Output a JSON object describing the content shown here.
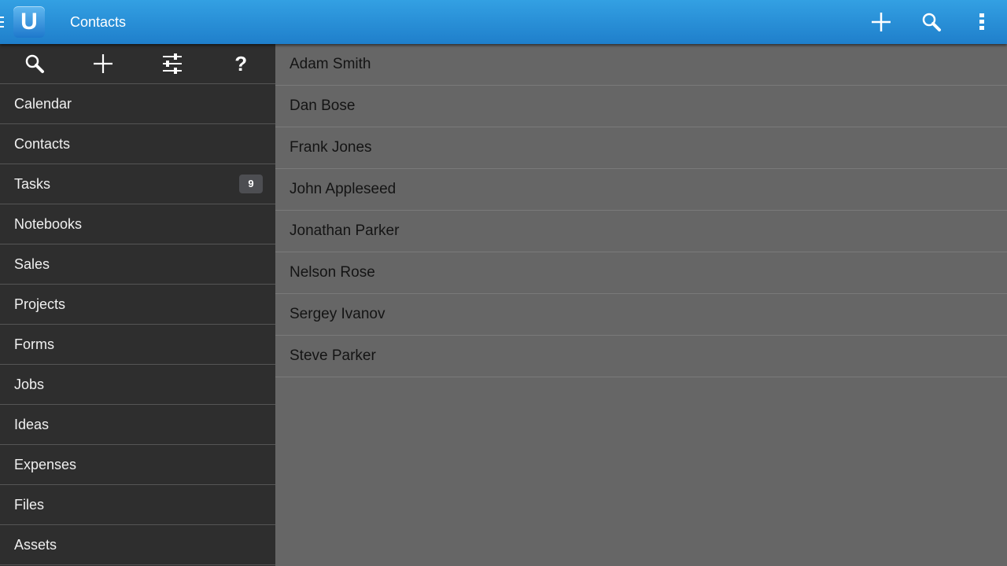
{
  "header": {
    "title": "Contacts",
    "logo_letter": "U",
    "actions": [
      {
        "name": "add",
        "icon": "plus-icon"
      },
      {
        "name": "search",
        "icon": "search-icon"
      },
      {
        "name": "overflow",
        "icon": "more-vert-icon"
      }
    ]
  },
  "sidebar": {
    "tools": [
      {
        "name": "search",
        "icon": "search-icon"
      },
      {
        "name": "add",
        "icon": "plus-icon"
      },
      {
        "name": "settings",
        "icon": "sliders-icon"
      },
      {
        "name": "help",
        "icon": "help-icon",
        "glyph": "?"
      }
    ],
    "items": [
      {
        "label": "Calendar"
      },
      {
        "label": "Contacts"
      },
      {
        "label": "Tasks",
        "badge": "9"
      },
      {
        "label": "Notebooks"
      },
      {
        "label": "Sales"
      },
      {
        "label": "Projects"
      },
      {
        "label": "Forms"
      },
      {
        "label": "Jobs"
      },
      {
        "label": "Ideas"
      },
      {
        "label": "Expenses"
      },
      {
        "label": "Files"
      },
      {
        "label": "Assets"
      }
    ]
  },
  "contacts": [
    "Adam Smith",
    "Dan Bose",
    "Frank Jones",
    "John Appleseed",
    "Jonathan Parker",
    "Nelson Rose",
    "Sergey Ivanov",
    "Steve Parker"
  ],
  "colors": {
    "header": "#2a8fd8",
    "sidebar": "#2e2e2e",
    "content": "#666666"
  }
}
